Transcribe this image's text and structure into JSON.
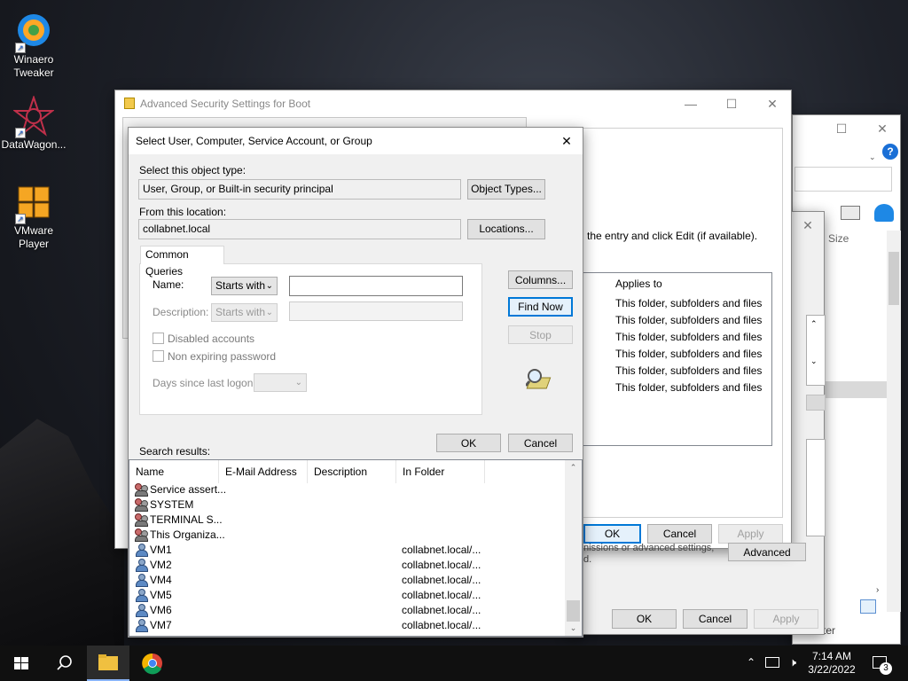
{
  "desktop": {
    "icons": [
      {
        "label": "Winaero Tweaker",
        "icon": "winaero-icon"
      },
      {
        "label": "DataWagon...",
        "icon": "datawagon-icon"
      },
      {
        "label": "VMware Player",
        "icon": "vmware-icon"
      }
    ]
  },
  "bg_window_right": {
    "size_col": "Size",
    "tail_text": "ter"
  },
  "adv_window": {
    "title": "Advanced Security Settings for Boot",
    "instruction": "the entry and click Edit (if available).",
    "applies_header": "Applies to",
    "applies_rows": [
      "This folder, subfolders and files",
      "This folder, subfolders and files",
      "This folder, subfolders and files",
      "This folder, subfolders and files",
      "This folder, subfolders and files",
      "This folder, subfolders and files"
    ],
    "ok": "OK",
    "cancel": "Cancel",
    "apply": "Apply",
    "note_line1": "nissions or advanced settings,",
    "note_line2": "d.",
    "advanced": "Advanced"
  },
  "perm_window": {
    "ok": "OK",
    "cancel": "Cancel",
    "apply": "Apply"
  },
  "dialog": {
    "title": "Select User, Computer, Service Account, or Group",
    "object_type_label": "Select this object type:",
    "object_type_value": "User, Group, or Built-in security principal",
    "object_types_btn": "Object Types...",
    "location_label": "From this location:",
    "location_value": "collabnet.local",
    "locations_btn": "Locations...",
    "tab": "Common Queries",
    "name_label": "Name:",
    "name_mode": "Starts with",
    "name_value": "",
    "desc_label": "Description:",
    "desc_mode": "Starts with",
    "disabled_accounts": "Disabled accounts",
    "non_expiring": "Non expiring password",
    "days_label": "Days since last logon:",
    "columns_btn": "Columns...",
    "find_now_btn": "Find Now",
    "stop_btn": "Stop",
    "ok": "OK",
    "cancel": "Cancel",
    "search_results_label": "Search results:",
    "columns": [
      "Name",
      "E-Mail Address",
      "Description",
      "In Folder"
    ],
    "results": [
      {
        "name": "Service assert...",
        "folder": "",
        "kind": "group"
      },
      {
        "name": "SYSTEM",
        "folder": "",
        "kind": "group"
      },
      {
        "name": "TERMINAL S...",
        "folder": "",
        "kind": "group"
      },
      {
        "name": "This Organiza...",
        "folder": "",
        "kind": "group"
      },
      {
        "name": "VM1",
        "folder": "collabnet.local/...",
        "kind": "user"
      },
      {
        "name": "VM2",
        "folder": "collabnet.local/...",
        "kind": "user"
      },
      {
        "name": "VM4",
        "folder": "collabnet.local/...",
        "kind": "user"
      },
      {
        "name": "VM5",
        "folder": "collabnet.local/...",
        "kind": "user"
      },
      {
        "name": "VM6",
        "folder": "collabnet.local/...",
        "kind": "user"
      },
      {
        "name": "VM7",
        "folder": "collabnet.local/...",
        "kind": "user"
      }
    ]
  },
  "taskbar": {
    "time": "7:14 AM",
    "date": "3/22/2022",
    "notifications": "3"
  }
}
